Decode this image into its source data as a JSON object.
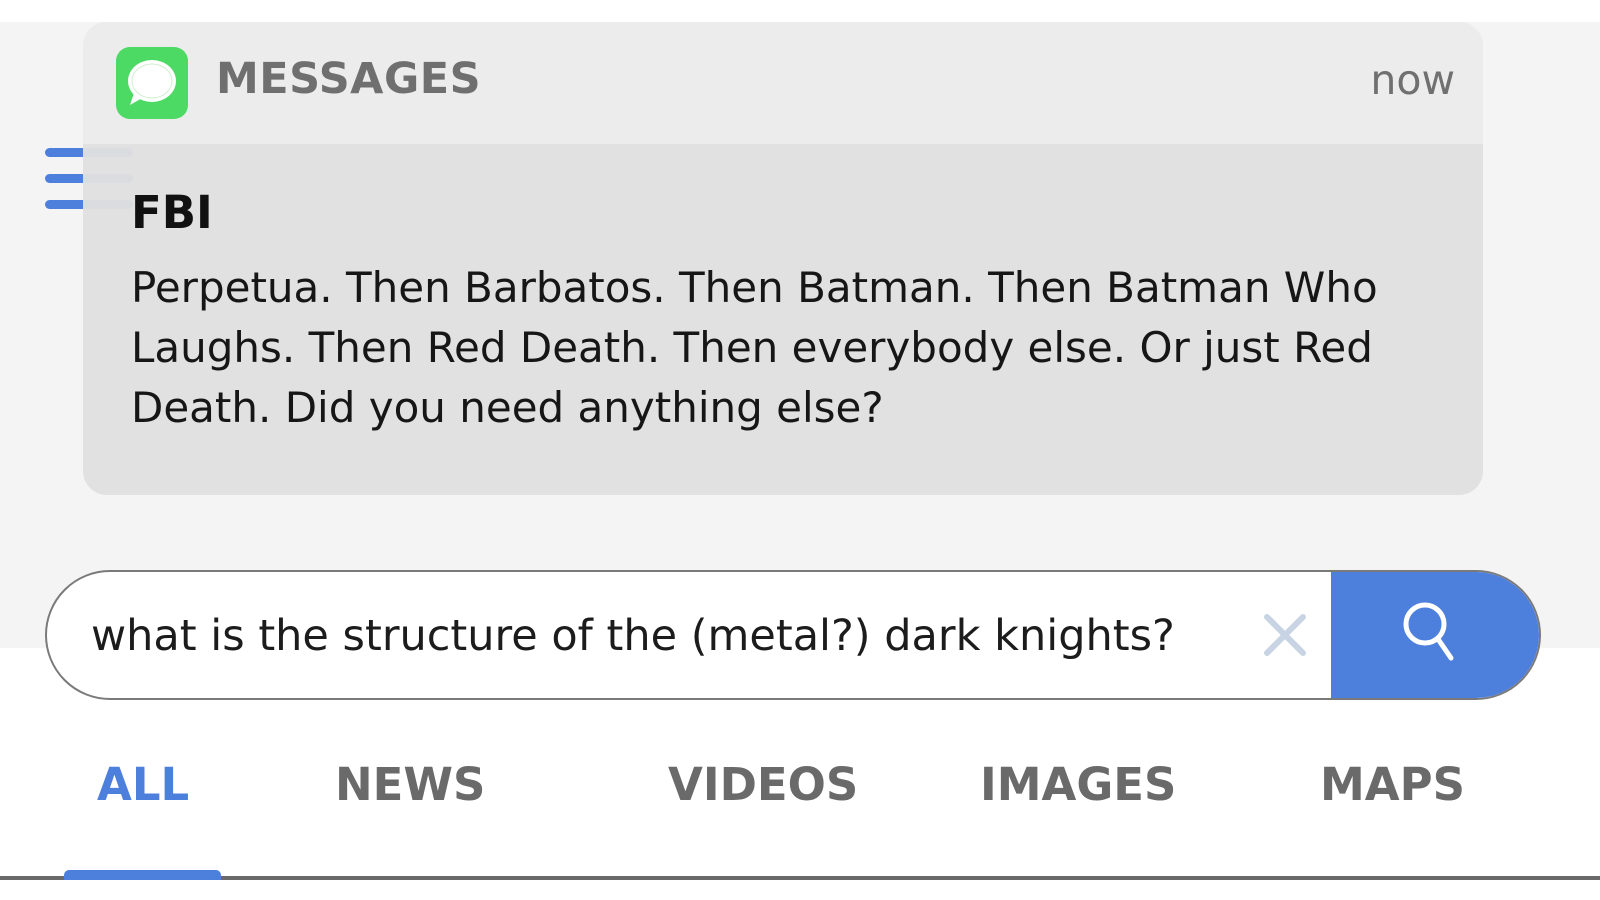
{
  "notification": {
    "app_name": "MESSAGES",
    "time": "now",
    "sender": "FBI",
    "message": "Perpetua. Then Barbatos. Then Batman. Then Batman Who Laughs. Then Red Death. Then everybody else. Or just Red Death. Did you need anything else?",
    "app_icon": "messages-app-icon"
  },
  "search": {
    "query": "what is the structure of the (metal?) dark knights?",
    "clear_icon": "close-icon",
    "submit_icon": "search-icon"
  },
  "tabs": [
    {
      "label": "ALL",
      "active": true
    },
    {
      "label": "NEWS",
      "active": false
    },
    {
      "label": "VIDEOS",
      "active": false
    },
    {
      "label": "IMAGES",
      "active": false
    },
    {
      "label": "MAPS",
      "active": false
    }
  ],
  "menu": {
    "icon": "hamburger-menu-icon"
  },
  "colors": {
    "accent": "#4d7fdc",
    "messages_green": "#4cd964",
    "notification_bg": "#e0e0e0",
    "panel_bg": "#f4f4f4"
  }
}
